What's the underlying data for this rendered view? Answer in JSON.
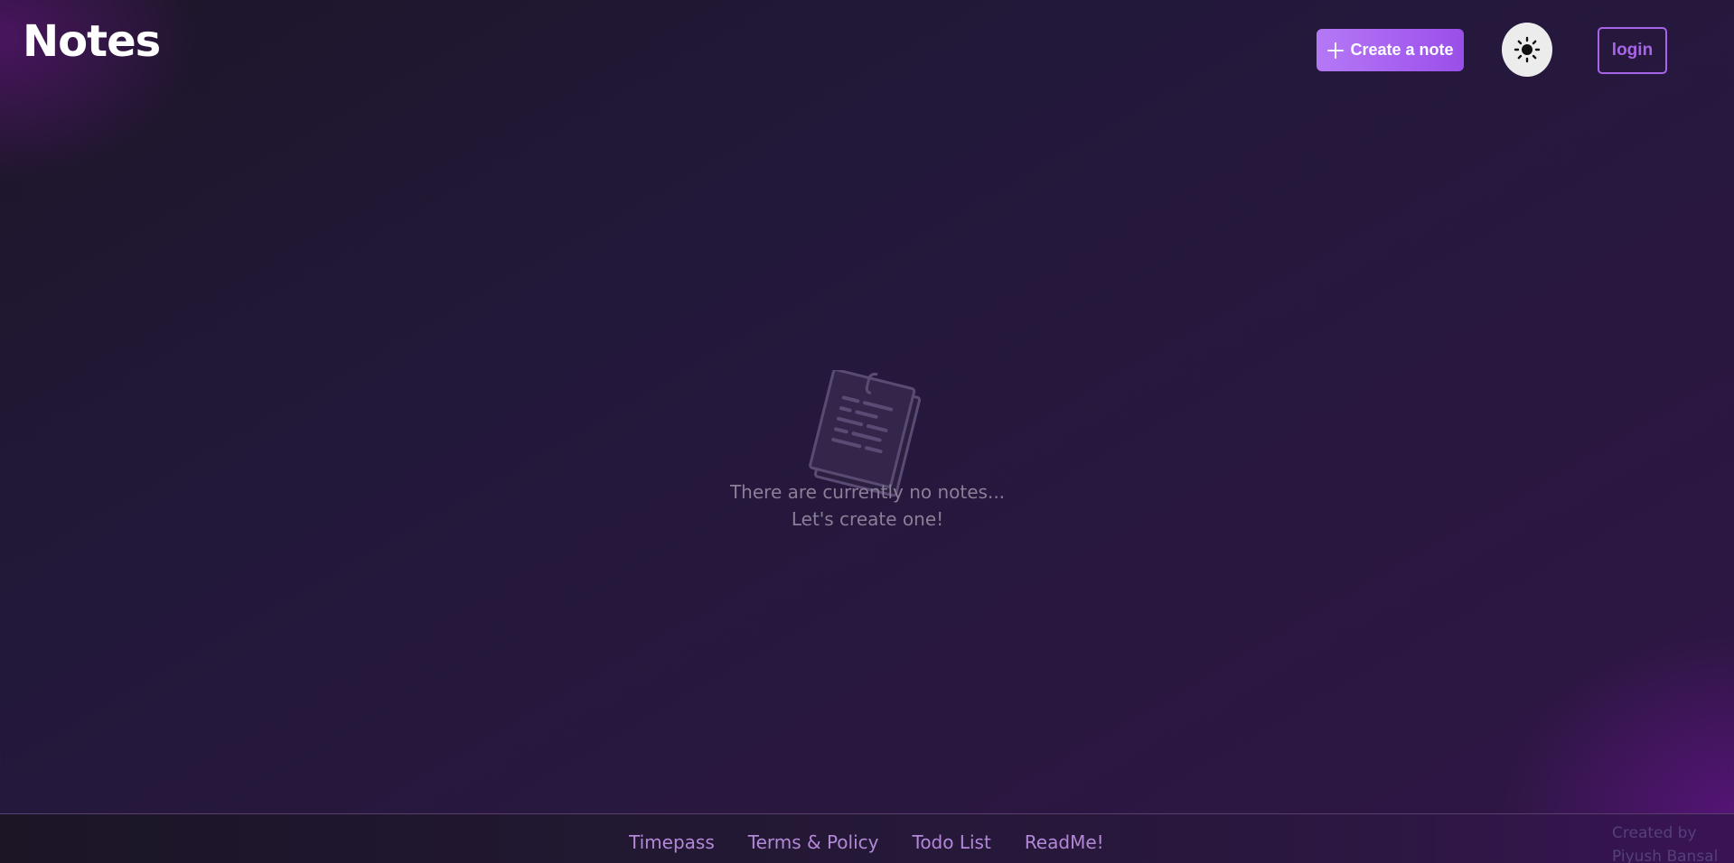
{
  "header": {
    "title": "Notes",
    "create_label": "Create a note",
    "login_label": "login"
  },
  "icons": {
    "create": "plus-icon",
    "theme": "sun-icon",
    "empty": "notepad-icon"
  },
  "empty_state": {
    "line1": "There are currently no notes...",
    "line2": "Let's create one!"
  },
  "footer": {
    "links": [
      "Timepass",
      "Terms & Policy",
      "Todo List",
      "ReadMe!"
    ],
    "credit_line1": "Created by",
    "credit_line2": "Piyush Bansal"
  },
  "colors": {
    "accent": "#a865e8",
    "button_gradient_start": "#b579f5",
    "background": "#22183a"
  }
}
